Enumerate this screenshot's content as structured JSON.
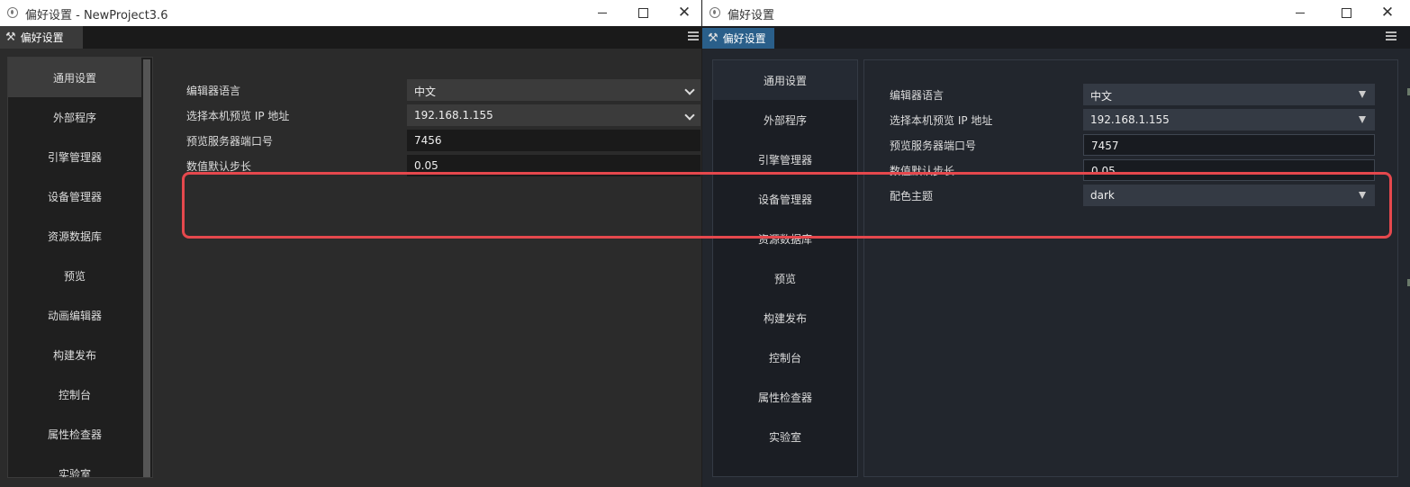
{
  "left_window": {
    "title": "偏好设置 - NewProject3.6",
    "tab_label": "偏好设置",
    "sidebar": [
      {
        "label": "通用设置",
        "active": true
      },
      {
        "label": "外部程序",
        "active": false
      },
      {
        "label": "引擎管理器",
        "active": false
      },
      {
        "label": "设备管理器",
        "active": false
      },
      {
        "label": "资源数据库",
        "active": false
      },
      {
        "label": "预览",
        "active": false
      },
      {
        "label": "动画编辑器",
        "active": false
      },
      {
        "label": "构建发布",
        "active": false
      },
      {
        "label": "控制台",
        "active": false
      },
      {
        "label": "属性检查器",
        "active": false
      },
      {
        "label": "实验室",
        "active": false
      }
    ],
    "settings": [
      {
        "label": "编辑器语言",
        "value": "中文",
        "type": "select"
      },
      {
        "label": "选择本机预览 IP 地址",
        "value": "192.168.1.155",
        "type": "select"
      },
      {
        "label": "预览服务器端口号",
        "value": "7456",
        "type": "input"
      },
      {
        "label": "数值默认步长",
        "value": "0.05",
        "type": "input"
      }
    ]
  },
  "right_window": {
    "title": "偏好设置",
    "tab_label": "偏好设置",
    "sidebar": [
      {
        "label": "通用设置",
        "active": true
      },
      {
        "label": "外部程序",
        "active": false
      },
      {
        "label": "引擎管理器",
        "active": false
      },
      {
        "label": "设备管理器",
        "active": false
      },
      {
        "label": "资源数据库",
        "active": false
      },
      {
        "label": "预览",
        "active": false
      },
      {
        "label": "构建发布",
        "active": false
      },
      {
        "label": "控制台",
        "active": false
      },
      {
        "label": "属性检查器",
        "active": false
      },
      {
        "label": "实验室",
        "active": false
      }
    ],
    "settings": [
      {
        "label": "编辑器语言",
        "value": "中文",
        "type": "select"
      },
      {
        "label": "选择本机预览 IP 地址",
        "value": "192.168.1.155",
        "type": "select"
      },
      {
        "label": "预览服务器端口号",
        "value": "7457",
        "type": "input"
      },
      {
        "label": "数值默认步长",
        "value": "0.05",
        "type": "input"
      },
      {
        "label": "配色主题",
        "value": "dark",
        "type": "select"
      }
    ]
  },
  "colors": {
    "highlight": "#e5484d",
    "right_tab_accent": "#2a5f8a"
  }
}
